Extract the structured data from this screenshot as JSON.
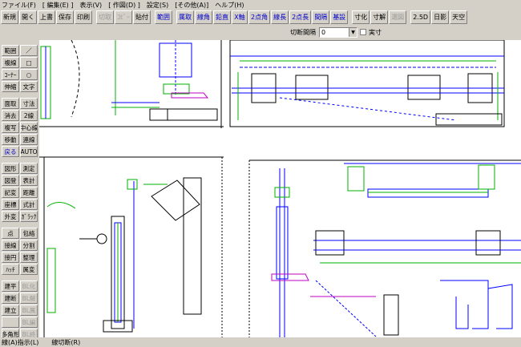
{
  "menu": [
    "ファイル(F)",
    "[ 編集(E) ]",
    "表示(V)",
    "[ 作図(D) ]",
    "設定(S)",
    "[その他(A)]",
    "ヘルプ(H)"
  ],
  "toolbar": [
    {
      "label": "新規",
      "style": "normal"
    },
    {
      "label": "開く",
      "style": "normal"
    },
    {
      "label": "上書",
      "style": "normal"
    },
    {
      "label": "保存",
      "style": "normal"
    },
    {
      "label": "印刷",
      "style": "normal"
    },
    {
      "label": "切取",
      "style": "disabled"
    },
    {
      "label": "ｺﾋﾟｰ",
      "style": "disabled"
    },
    {
      "label": "貼付",
      "style": "normal"
    },
    {
      "label": "範囲",
      "style": "blue"
    },
    {
      "label": "属取",
      "style": "blue"
    },
    {
      "label": "線角",
      "style": "blue"
    },
    {
      "label": "鉛直",
      "style": "blue"
    },
    {
      "label": "X軸",
      "style": "blue"
    },
    {
      "label": "2点角",
      "style": "blue"
    },
    {
      "label": "線長",
      "style": "blue"
    },
    {
      "label": "2点長",
      "style": "blue"
    },
    {
      "label": "間隔",
      "style": "blue"
    },
    {
      "label": "基設",
      "style": "blue"
    },
    {
      "label": "寸化",
      "style": "normal"
    },
    {
      "label": "寸解",
      "style": "normal"
    },
    {
      "label": "選図",
      "style": "disabled"
    },
    {
      "label": "2.5D",
      "style": "normal"
    },
    {
      "label": "日影",
      "style": "normal"
    },
    {
      "label": "天空",
      "style": "normal"
    }
  ],
  "subbar": {
    "label": "切断間隔",
    "value": "0",
    "checkbox_label": "実寸"
  },
  "left_tools": [
    {
      "label": "範囲",
      "style": "normal"
    },
    {
      "label": "／",
      "style": "normal"
    },
    {
      "label": "複線",
      "style": "normal"
    },
    {
      "label": "□",
      "style": "normal"
    },
    {
      "label": "ｺｰﾅｰ",
      "style": "normal"
    },
    {
      "label": "○",
      "style": "normal"
    },
    {
      "label": "伸縮",
      "style": "normal"
    },
    {
      "label": "文字",
      "style": "normal"
    },
    {
      "label": "面取",
      "style": "normal"
    },
    {
      "label": "寸法",
      "style": "normal"
    },
    {
      "label": "消去",
      "style": "normal"
    },
    {
      "label": "2線",
      "style": "normal"
    },
    {
      "label": "複写",
      "style": "normal"
    },
    {
      "label": "中心線",
      "style": "normal"
    },
    {
      "label": "移動",
      "style": "normal"
    },
    {
      "label": "連線",
      "style": "normal"
    },
    {
      "label": "戻る",
      "style": "blue"
    },
    {
      "label": "AUTO",
      "style": "normal"
    },
    {
      "label": "図形",
      "style": "normal"
    },
    {
      "label": "測定",
      "style": "normal"
    },
    {
      "label": "図登",
      "style": "normal"
    },
    {
      "label": "表計",
      "style": "normal"
    },
    {
      "label": "記変",
      "style": "normal"
    },
    {
      "label": "距離",
      "style": "normal"
    },
    {
      "label": "座標",
      "style": "normal"
    },
    {
      "label": "式計",
      "style": "normal"
    },
    {
      "label": "外変",
      "style": "normal"
    },
    {
      "label": "ｶﾞﾗｯｸ",
      "style": "normal"
    },
    {
      "label": "点",
      "style": "normal"
    },
    {
      "label": "包絡",
      "style": "normal"
    },
    {
      "label": "接線",
      "style": "normal"
    },
    {
      "label": "分割",
      "style": "normal"
    },
    {
      "label": "接円",
      "style": "normal"
    },
    {
      "label": "整理",
      "style": "normal"
    },
    {
      "label": "ﾊｯﾁ",
      "style": "normal"
    },
    {
      "label": "属変",
      "style": "normal"
    },
    {
      "label": "建平",
      "style": "normal"
    },
    {
      "label": "BL化",
      "style": "disabled"
    },
    {
      "label": "建断",
      "style": "normal"
    },
    {
      "label": "BL解",
      "style": "disabled"
    },
    {
      "label": "建立",
      "style": "normal"
    },
    {
      "label": "BL属",
      "style": "disabled"
    },
    {
      "label": "",
      "style": "normal"
    },
    {
      "label": "BL編",
      "style": "disabled"
    },
    {
      "label": "多角形",
      "style": "normal"
    },
    {
      "label": "BL終",
      "style": "disabled"
    },
    {
      "label": "曲線",
      "style": "normal"
    },
    {
      "label": "BL",
      "style": "disabled"
    }
  ],
  "status": {
    "left": "線(A)指示(L)",
    "right": "線切断(R)"
  },
  "colors": {
    "ui_bg": "#d4d0c8",
    "canvas_bg": "#ffffff",
    "line_blue": "#0000ff",
    "line_green": "#00b000",
    "line_black": "#000000",
    "hatch_magenta": "#c000c0"
  }
}
